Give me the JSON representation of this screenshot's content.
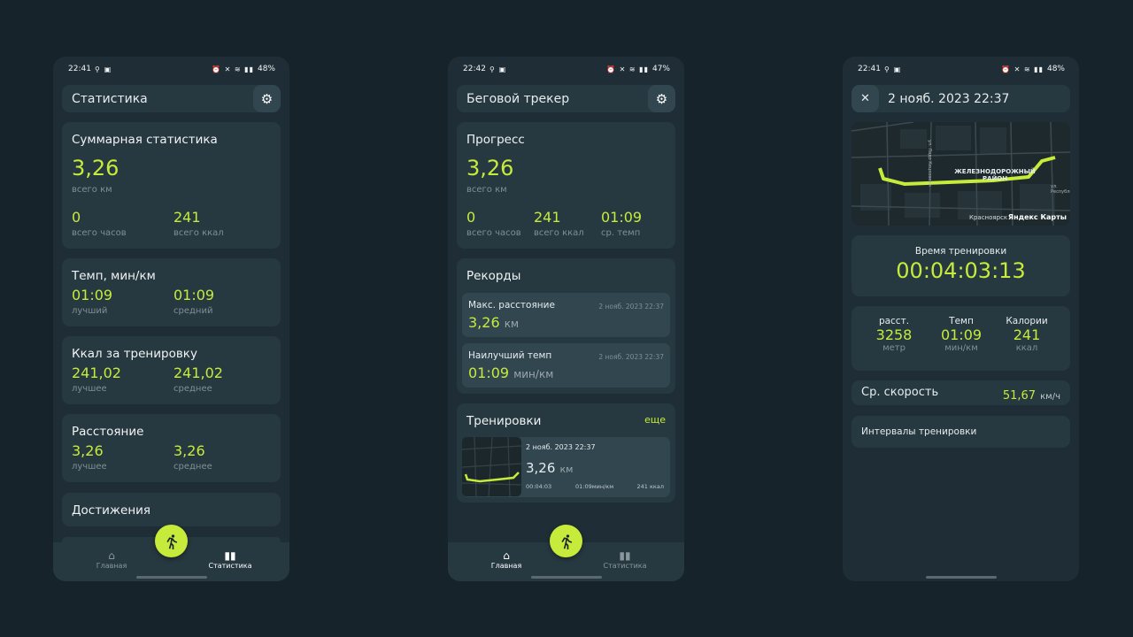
{
  "colors": {
    "background": "#17232a",
    "card": "#273940",
    "accent": "#c6eb3b",
    "muted": "#7f8f96"
  },
  "icons": {
    "gear": "gear-icon",
    "run": "running-person-icon",
    "home": "home-icon",
    "stats": "bar-chart-icon",
    "close": "close-icon",
    "location": "location-pin-icon",
    "image": "image-icon"
  },
  "screen1": {
    "status": {
      "time": "22:41",
      "battery": "48%"
    },
    "header": {
      "title": "Статистика"
    },
    "summary": {
      "title": "Суммарная статистика",
      "km": "3,26",
      "km_label": "всего км",
      "hours": "0",
      "hours_label": "всего часов",
      "kcal": "241",
      "kcal_label": "всего ккал"
    },
    "pace": {
      "title": "Темп, мин/км",
      "best": "01:09",
      "best_label": "лучший",
      "avg": "01:09",
      "avg_label": "средний"
    },
    "kcal_workout": {
      "title": "Ккал за тренировку",
      "best": "241,02",
      "best_label": "лучшее",
      "avg": "241,02",
      "avg_label": "среднее"
    },
    "distance": {
      "title": "Расстояние",
      "best": "3,26",
      "best_label": "лучшее",
      "avg": "3,26",
      "avg_label": "среднее"
    },
    "achievements": {
      "title": "Достижения"
    },
    "nav": {
      "home": "Главная",
      "stats": "Статистика"
    }
  },
  "screen2": {
    "status": {
      "time": "22:42",
      "battery": "47%"
    },
    "header": {
      "title": "Беговой трекер"
    },
    "progress": {
      "title": "Прогресс",
      "km": "3,26",
      "km_label": "всего км",
      "hours": "0",
      "hours_label": "всего часов",
      "kcal": "241",
      "kcal_label": "всего ккал",
      "pace": "01:09",
      "pace_label": "ср. темп"
    },
    "records": {
      "title": "Рекорды",
      "items": [
        {
          "label": "Макс. расстояние",
          "date": "2 нояб. 2023 22:37",
          "value": "3,26",
          "unit": "км"
        },
        {
          "label": "Наилучший темп",
          "date": "2 нояб. 2023 22:37",
          "value": "01:09",
          "unit": "мин/км"
        }
      ]
    },
    "workouts": {
      "title": "Тренировки",
      "more": "еще",
      "item": {
        "date": "2 нояб. 2023 22:37",
        "distance": "3,26",
        "unit": "км",
        "time": "00:04:03",
        "pace": "01:09мин/км",
        "kcal": "241 ккал"
      }
    },
    "nav": {
      "home": "Главная",
      "stats": "Статистика"
    }
  },
  "screen3": {
    "status": {
      "time": "22:41",
      "battery": "48%"
    },
    "header": {
      "title": "2 нояб. 2023 22:37"
    },
    "map": {
      "district": "ЖЕЛЕЗНОДОРОЖНЫЙ",
      "district2": "РАЙОН",
      "city": "Красноярск",
      "brand": "Яндекс Карты",
      "street1": "ул. Ладо Кецховели",
      "street2": "ул. Республики"
    },
    "time_card": {
      "label": "Время тренировки",
      "value": "00:04:03:13"
    },
    "stats": [
      {
        "label": "расст.",
        "value": "3258",
        "unit": "метр"
      },
      {
        "label": "Темп",
        "value": "01:09",
        "unit": "мин/км"
      },
      {
        "label": "Калории",
        "value": "241",
        "unit": "ккал"
      }
    ],
    "speed": {
      "label": "Ср. скорость",
      "value": "51,67",
      "unit": "км/ч"
    },
    "intervals": {
      "label": "Интервалы тренировки"
    }
  }
}
